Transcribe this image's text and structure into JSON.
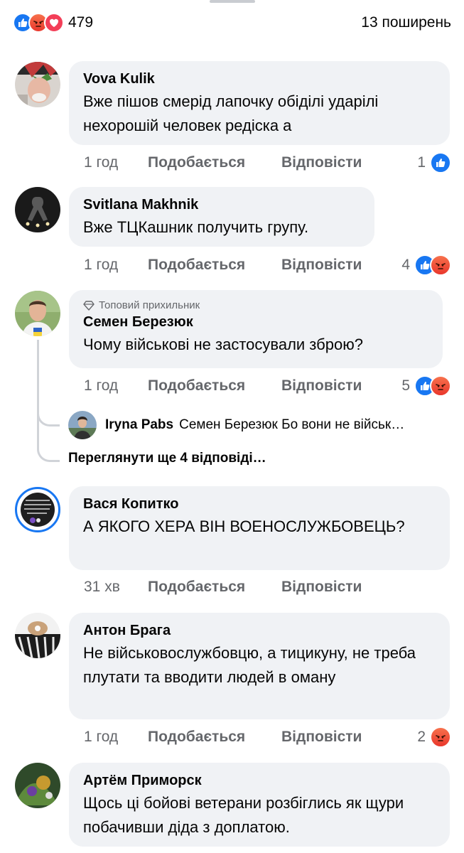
{
  "header": {
    "reaction_count": "479",
    "shares": "13 поширень",
    "reactions": [
      "like-icon",
      "angry-icon",
      "love-icon"
    ]
  },
  "action_labels": {
    "like": "Подобається",
    "reply": "Відповісти"
  },
  "colors": {
    "like": "#1877f2",
    "angry": "#e9372c",
    "love": "#f33e58",
    "bubble": "#f0f2f5",
    "meta": "#65676b"
  },
  "comments": [
    {
      "name": "Vova Kulik",
      "text": "Вже пішов смерід лапочку обіділі ударілі нехорошій человек редіска а",
      "time": "1 год",
      "reaction_count": "1",
      "reactions": [
        "like"
      ]
    },
    {
      "name": "Svitlana Makhnik",
      "text": "Вже ТЦКашник получить групу.",
      "time": "1 год",
      "reaction_count": "4",
      "reactions": [
        "like",
        "angry"
      ]
    },
    {
      "badge": "Топовий прихильник",
      "name": "Семен Березюк",
      "text": "Чому військові не застосували зброю?",
      "time": "1 год",
      "reaction_count": "5",
      "reactions": [
        "like",
        "angry"
      ]
    },
    {
      "name": "Вася Копитко",
      "text": "А ЯКОГО ХЕРА ВІН ВОЕНОСЛУЖБОВЕЦЬ?",
      "time": "31 хв",
      "avatar_text": "ти, что страдаете?! Держ на к..й всегда без пробок!"
    },
    {
      "name": "Антон Брага",
      "text": "Не військовослужбовцю, а тицикуну, не треба плутати та вводити людей в оману",
      "time": "1 год",
      "reaction_count": "2",
      "reactions": [
        "angry"
      ]
    },
    {
      "name": "Артём Приморск",
      "text": "Щось ці бойові ветерани розбіглись як щури побачивши діда з доплатою."
    }
  ],
  "subreply": {
    "name": "Iryna Pabs",
    "text": "Семен Березюк Бо вони не військ…"
  },
  "view_more": "Переглянути ще 4 відповіді…"
}
